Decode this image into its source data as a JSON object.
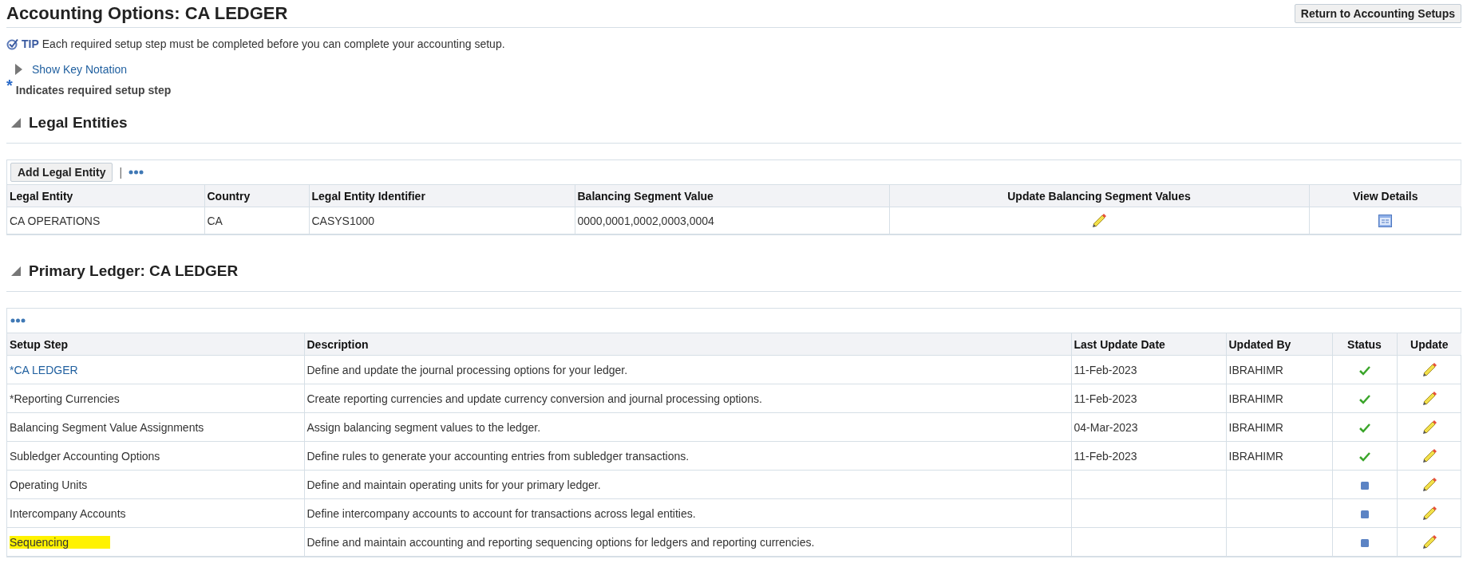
{
  "page": {
    "title": "Accounting Options: CA LEDGER",
    "return_button": "Return to Accounting Setups"
  },
  "tip": {
    "label": "TIP",
    "text": "Each required setup step must be completed before you can complete your accounting setup."
  },
  "key_notation": {
    "label": "Show Key Notation",
    "expanded": false
  },
  "required_note": {
    "mark": "*",
    "text": "Indicates required setup step"
  },
  "legal_entities": {
    "heading": "Legal Entities",
    "expanded": true,
    "add_button": "Add Legal Entity",
    "separator": "|",
    "columns": [
      "Legal Entity",
      "Country",
      "Legal Entity Identifier",
      "Balancing Segment Value",
      "Update Balancing Segment Values",
      "View Details"
    ],
    "rows": [
      {
        "legal_entity": "CA OPERATIONS",
        "country": "CA",
        "identifier": "CASYS1000",
        "balancing_segment_value": "0000,0001,0002,0003,0004"
      }
    ]
  },
  "primary_ledger": {
    "heading": "Primary Ledger: CA LEDGER",
    "expanded": true,
    "columns": [
      "Setup Step",
      "Description",
      "Last Update Date",
      "Updated By",
      "Status",
      "Update"
    ],
    "rows": [
      {
        "step": "*CA LEDGER",
        "link": true,
        "highlighted": false,
        "description": "Define and update the journal processing options for your ledger.",
        "last_update_date": "11-Feb-2023",
        "updated_by": "IBRAHIMR",
        "complete": true
      },
      {
        "step": "*Reporting Currencies",
        "link": false,
        "highlighted": false,
        "description": "Create reporting currencies and update currency conversion and journal processing options.",
        "last_update_date": "11-Feb-2023",
        "updated_by": "IBRAHIMR",
        "complete": true
      },
      {
        "step": "Balancing Segment Value Assignments",
        "link": false,
        "highlighted": false,
        "description": "Assign balancing segment values to the ledger.",
        "last_update_date": "04-Mar-2023",
        "updated_by": "IBRAHIMR",
        "complete": true
      },
      {
        "step": "Subledger Accounting Options",
        "link": false,
        "highlighted": false,
        "description": "Define rules to generate your accounting entries from subledger transactions.",
        "last_update_date": "11-Feb-2023",
        "updated_by": "IBRAHIMR",
        "complete": true
      },
      {
        "step": "Operating Units",
        "link": false,
        "highlighted": false,
        "description": "Define and maintain operating units for your primary ledger.",
        "complete": false
      },
      {
        "step": "Intercompany Accounts",
        "link": false,
        "highlighted": false,
        "description": "Define intercompany accounts to account for transactions across legal entities.",
        "complete": false
      },
      {
        "step": "Sequencing",
        "link": false,
        "highlighted": true,
        "description": "Define and maintain accounting and reporting sequencing options for ledgers and reporting currencies.",
        "complete": false
      }
    ]
  }
}
